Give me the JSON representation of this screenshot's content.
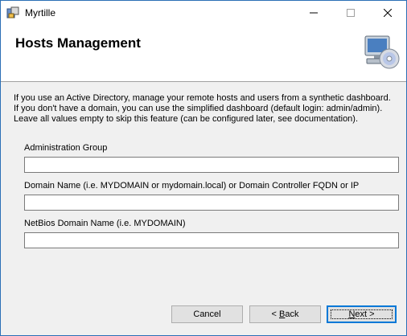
{
  "window": {
    "title": "Myrtille",
    "minimize_icon": "minimize-icon",
    "maximize_icon": "maximize-icon",
    "close_icon": "close-icon"
  },
  "header": {
    "title": "Hosts Management",
    "icon": "computer-disc-icon"
  },
  "intro": {
    "lines": [
      "If you use an Active Directory, manage your remote hosts and users from a synthetic dashboard.",
      "If you don't have a domain, you can use the simplified dashboard (default login: admin/admin).",
      "Leave all values empty to skip this feature (can be configured later, see documentation)."
    ]
  },
  "fields": [
    {
      "label": "Administration Group",
      "value": ""
    },
    {
      "label": "Domain Name (i.e. MYDOMAIN or mydomain.local) or Domain Controller FQDN or IP",
      "value": ""
    },
    {
      "label": "NetBios Domain Name (i.e. MYDOMAIN)",
      "value": ""
    }
  ],
  "buttons": {
    "cancel": "Cancel",
    "back_prefix": "< ",
    "back_access": "B",
    "back_rest": "ack",
    "next_access": "N",
    "next_rest": "ext >"
  },
  "colors": {
    "desktop": "#1a5fa8",
    "dialog_bg": "#f0f0f0",
    "accent": "#0078d7"
  }
}
